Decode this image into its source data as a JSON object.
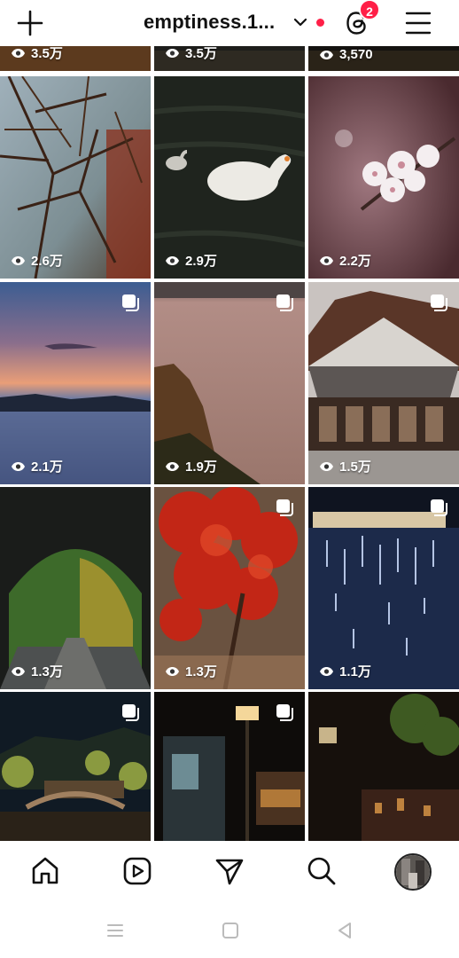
{
  "header": {
    "username": "emptiness.1...",
    "threads_badge": "2",
    "icons": [
      "plus-icon",
      "chevron-down-icon",
      "threads-icon",
      "menu-icon"
    ]
  },
  "grid": {
    "partial_row": [
      "3.5万",
      "3.5万",
      "3,570"
    ],
    "tiles": [
      {
        "views": "2.6万",
        "subject": "bare branches",
        "multi": false
      },
      {
        "views": "2.9万",
        "subject": "swans on dark water",
        "multi": false
      },
      {
        "views": "2.2万",
        "subject": "cherry blossom",
        "multi": false
      },
      {
        "views": "2.1万",
        "subject": "sunset over bay",
        "multi": true
      },
      {
        "views": "1.9万",
        "subject": "sea cliff",
        "multi": true
      },
      {
        "views": "1.5万",
        "subject": "temple",
        "multi": true
      },
      {
        "views": "1.3万",
        "subject": "tunnel",
        "multi": false
      },
      {
        "views": "1.3万",
        "subject": "red maple",
        "multi": true
      },
      {
        "views": "1.1万",
        "subject": "night lights on river",
        "multi": true
      },
      {
        "views": "",
        "subject": "night village bridge",
        "multi": true
      },
      {
        "views": "",
        "subject": "street lamp",
        "multi": true
      },
      {
        "views": "",
        "subject": "night alley",
        "multi": false
      }
    ]
  },
  "nav": {
    "items": [
      "home-icon",
      "reels-icon",
      "send-icon",
      "search-icon",
      "profile-avatar"
    ]
  },
  "system_nav": [
    "recents-icon",
    "home-square-icon",
    "back-icon"
  ],
  "colors": {
    "badge": "#ff1f47",
    "text": "#111111"
  }
}
